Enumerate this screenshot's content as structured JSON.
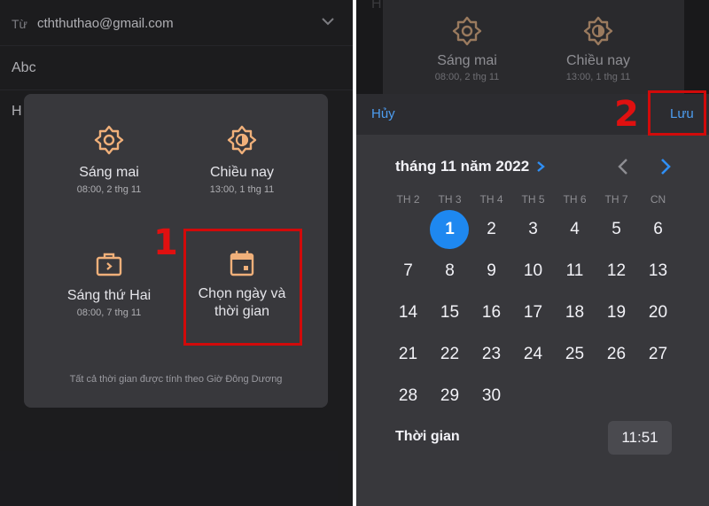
{
  "left": {
    "from_label": "Từ",
    "from_email": "cththuthao@gmail.com",
    "subject": "Abc",
    "body_peek": "H",
    "snooze": {
      "options": [
        {
          "label": "Sáng mai",
          "time": "08:00, 2 thg 11",
          "icon": "sun-icon"
        },
        {
          "label": "Chiều nay",
          "time": "13:00, 1 thg 11",
          "icon": "half-sun-icon"
        },
        {
          "label": "Sáng thứ Hai",
          "time": "08:00, 7 thg 11",
          "icon": "briefcase-icon"
        },
        {
          "label_line1": "Chọn ngày và",
          "label_line2": "thời gian",
          "icon": "calendar-icon"
        }
      ],
      "timezone_note": "Tất cả thời gian được tính theo Giờ Đông Dương"
    },
    "step_number": "1"
  },
  "right": {
    "peek": {
      "letter": "H",
      "options": [
        {
          "label": "Sáng mai",
          "time": "08:00, 2 thg 11"
        },
        {
          "label": "Chiều nay",
          "time": "13:00, 1 thg 11"
        }
      ]
    },
    "header": {
      "cancel": "Hủy",
      "save": "Lưu"
    },
    "step_number": "2",
    "calendar": {
      "month_title": "tháng 11 năm 2022",
      "weekdays": [
        "TH 2",
        "TH 3",
        "TH 4",
        "TH 5",
        "TH 6",
        "TH 7",
        "CN"
      ],
      "first_weekday_index": 1,
      "days_in_month": 30,
      "selected_day": 1
    },
    "time": {
      "label": "Thời gian",
      "value": "11:51"
    }
  },
  "colors": {
    "accent": "#1e88f0",
    "link": "#4d9df0",
    "icon_orange": "#f0b07a",
    "highlight_red": "#d10a0a"
  }
}
